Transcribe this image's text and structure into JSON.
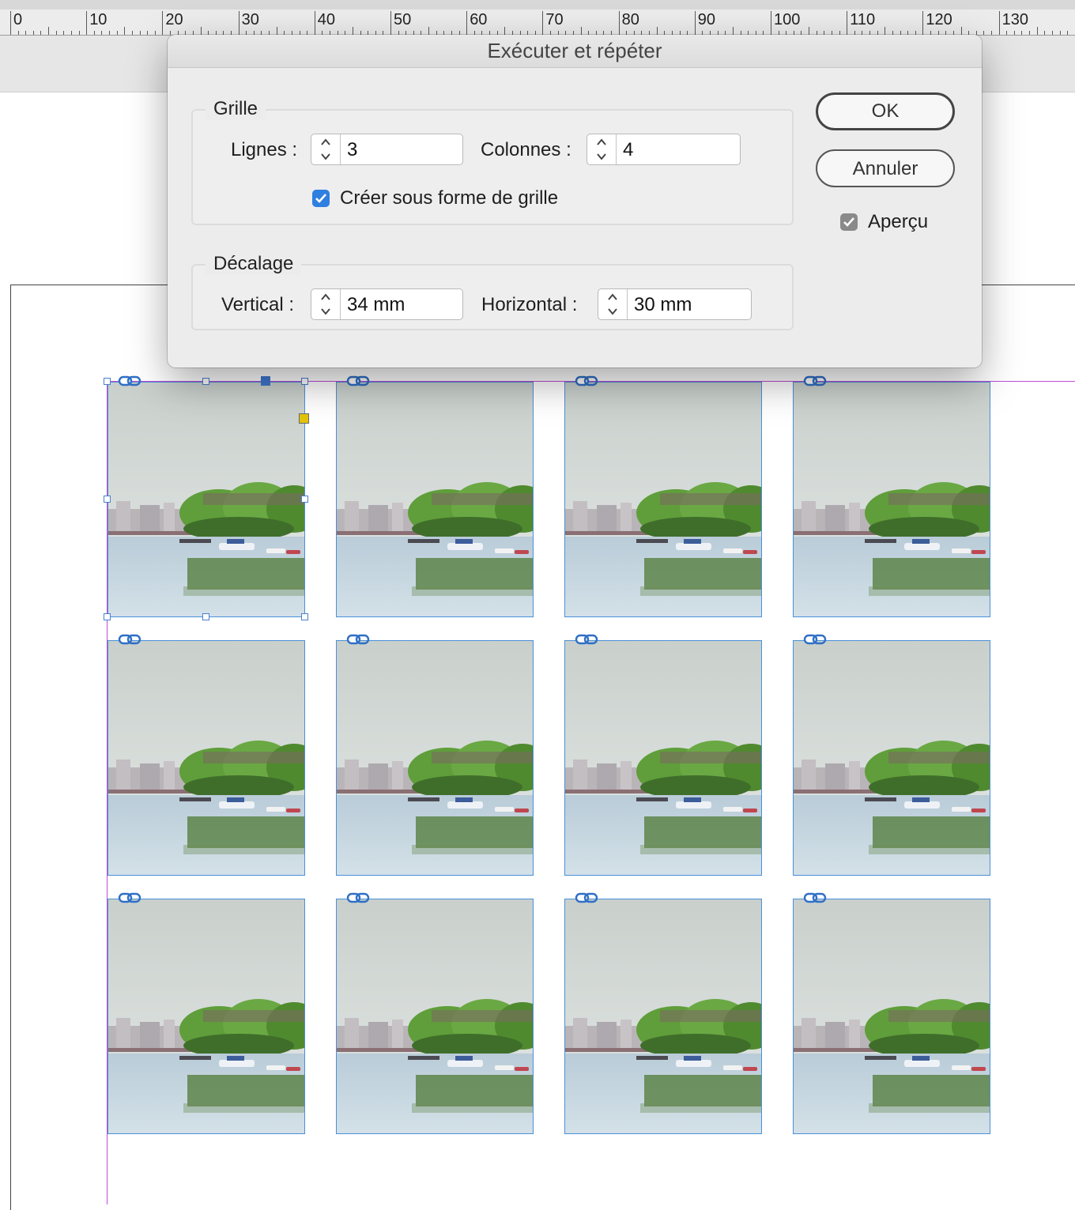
{
  "ruler": {
    "unit_labels": [
      "0",
      "10",
      "20",
      "30",
      "40",
      "50",
      "60",
      "70",
      "80",
      "90",
      "100",
      "110",
      "120",
      "130"
    ]
  },
  "dialog": {
    "title": "Exécuter et répéter",
    "grid_group": {
      "title": "Grille",
      "rows_label": "Lignes :",
      "rows_value": "3",
      "columns_label": "Colonnes :",
      "columns_value": "4",
      "create_as_grid_label": "Créer sous forme de grille",
      "create_as_grid_checked": true
    },
    "offset_group": {
      "title": "Décalage",
      "vertical_label": "Vertical :",
      "vertical_value": "34 mm",
      "horizontal_label": "Horizontal :",
      "horizontal_value": "30 mm"
    },
    "ok_label": "OK",
    "cancel_label": "Annuler",
    "preview_label": "Aperçu",
    "preview_checked": true
  },
  "canvas": {
    "grid_rows": 3,
    "grid_columns": 4,
    "frame_content": "river landscape photo",
    "link_icon": "link-chain-icon"
  },
  "colors": {
    "checkbox_accent": "#2f7fe0",
    "frame_border": "#4a90d9",
    "margin_guide": "#c04bd6"
  }
}
